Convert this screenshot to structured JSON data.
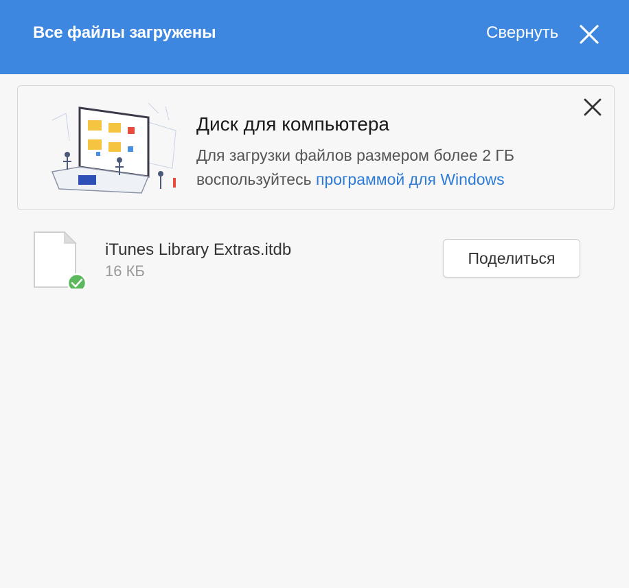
{
  "header": {
    "title": "Все файлы загружены",
    "collapse_label": "Свернуть",
    "close_icon": "close-icon",
    "background": "#3d87e0"
  },
  "promo": {
    "title": "Диск для компьютера",
    "text": "Для загрузки файлов размером более 2 ГБ воспользуйтесь ",
    "link_text": "программой для Windows",
    "link_color": "#2e7bd6",
    "close_icon": "close-icon"
  },
  "file": {
    "name": "iTunes Library Extras.itdb",
    "size": "16 КБ",
    "status_icon": "check-circle-icon",
    "status_color": "#5cb85c",
    "share_label": "Поделиться"
  }
}
